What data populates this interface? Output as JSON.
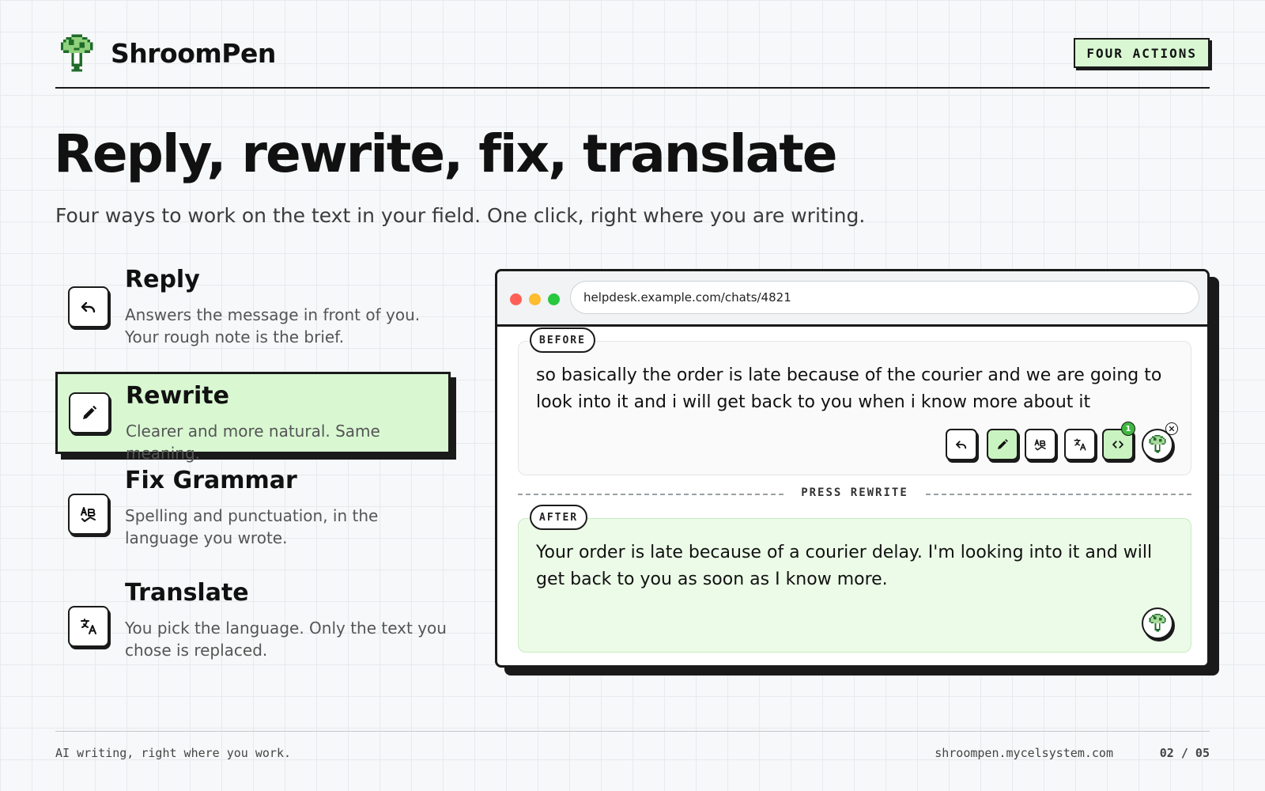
{
  "header": {
    "brand_name": "ShroomPen",
    "brand_icon": "mushroom-icon",
    "badge": "FOUR ACTIONS"
  },
  "hero": {
    "title": "Reply, rewrite, fix, translate",
    "subtitle": "Four ways to work on the text in your field. One click, right where you are writing."
  },
  "features": [
    {
      "title": "Reply",
      "description": "Answers the message in front of you. Your rough note is the brief.",
      "icon": "reply-icon",
      "active": false
    },
    {
      "title": "Rewrite",
      "description": "Clearer and more natural. Same meaning.",
      "icon": "pencil-icon",
      "active": true
    },
    {
      "title": "Fix Grammar",
      "description": "Spelling and punctuation, in the language you wrote.",
      "icon": "spellcheck-icon",
      "active": false
    },
    {
      "title": "Translate",
      "description": "You pick the language. Only the text you chose is replaced.",
      "icon": "translate-icon",
      "active": false
    }
  ],
  "browser": {
    "url": "helpdesk.example.com/chats/4821",
    "before_label": "BEFORE",
    "before_text": "so basically the order is late because of the courier and we are going to look into it and i will get back to you when i know more about it",
    "divider_label": "PRESS REWRITE",
    "after_label": "AFTER",
    "after_text": "Your order is late because of a courier delay. I'm looking into it and will get back to you as soon as I know more.",
    "toolbar": {
      "buttons": [
        "reply-icon",
        "pencil-icon",
        "spellcheck-icon",
        "translate-icon",
        "code-icon"
      ],
      "code_count": "1",
      "mushroom_icon": "mushroom-icon",
      "close_icon": "close-icon"
    }
  },
  "footer": {
    "tagline": "AI writing, right where you work.",
    "url": "shroompen.mycelsystem.com",
    "page": "02 / 05"
  },
  "colors": {
    "accent_green": "#d9f8d2",
    "after_bg": "#ecfbe8",
    "ink": "#1a1a1a",
    "dot_red": "#ff5f57",
    "dot_yellow": "#febc2e",
    "dot_green": "#28c840",
    "count_badge": "#3fb73f"
  }
}
